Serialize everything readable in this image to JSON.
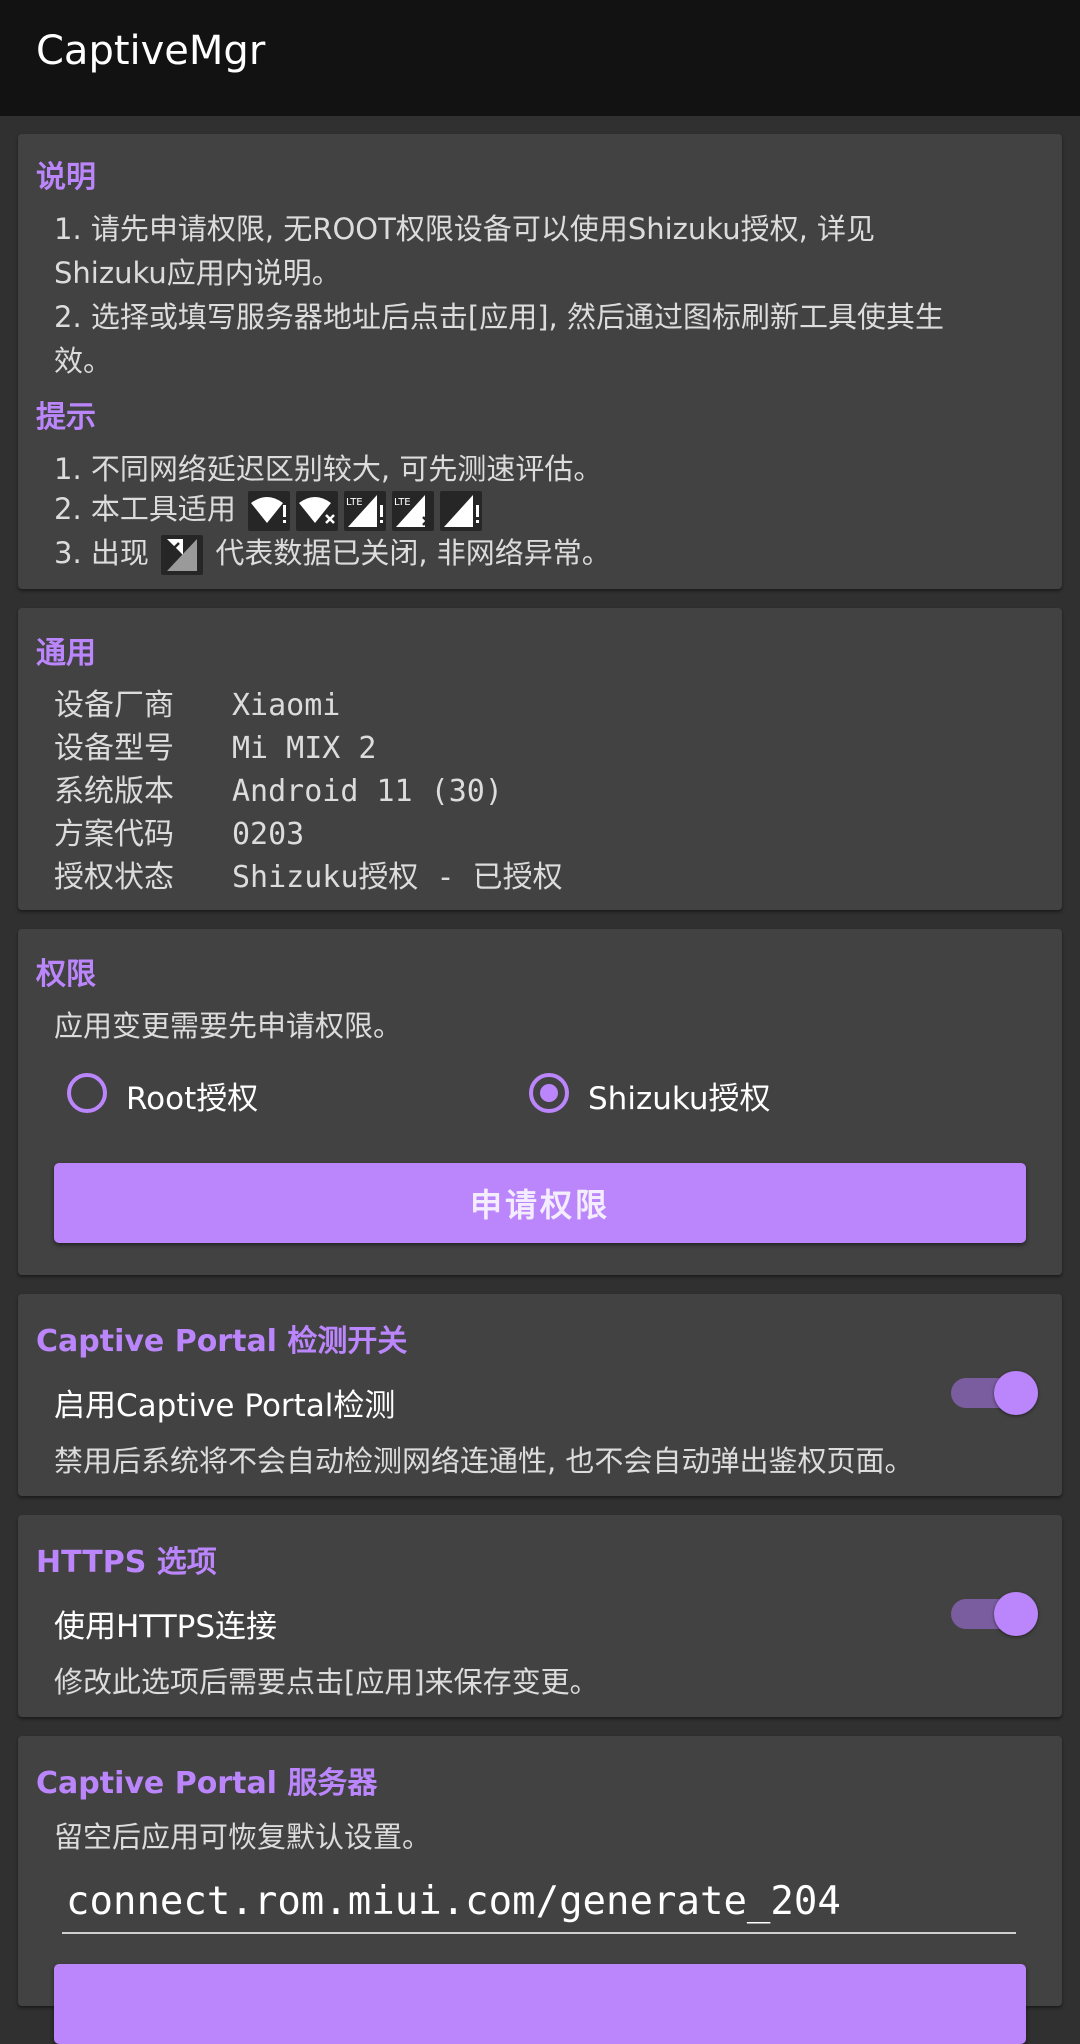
{
  "app": {
    "title": "CaptiveMgr"
  },
  "instructions": {
    "title": "说明",
    "lines": [
      "1. 请先申请权限, 无ROOT权限设备可以使用Shizuku授权, 详见",
      "Shizuku应用内说明。",
      "2. 选择或填写服务器地址后点击[应用], 然后通过图标刷新工具使其生",
      "效。"
    ]
  },
  "tips": {
    "title": "提示",
    "line1": "1. 不同网络延迟区别较大, 可先测速评估。",
    "line2_prefix": "2. 本工具适用",
    "line3_prefix": "3. 出现",
    "line3_suffix": "代表数据已关闭, 非网络异常。",
    "icons": [
      "wifi-exclamation-icon",
      "wifi-x-icon",
      "lte-exclamation-icon",
      "lte-x-icon",
      "signal-exclamation-icon",
      "mobile-data-off-icon"
    ],
    "lte_text": "LTE"
  },
  "general": {
    "title": "通用",
    "rows": [
      {
        "label": "设备厂商",
        "value": "Xiaomi"
      },
      {
        "label": "设备型号",
        "value": "Mi MIX 2"
      },
      {
        "label": "系统版本",
        "value": "Android 11 (30)"
      },
      {
        "label": "方案代码",
        "value": "0203"
      },
      {
        "label": "授权状态",
        "value": "Shizuku授权 - 已授权"
      }
    ]
  },
  "permission": {
    "title": "权限",
    "desc": "应用变更需要先申请权限。",
    "options": [
      {
        "label": "Root授权",
        "selected": false
      },
      {
        "label": "Shizuku授权",
        "selected": true
      }
    ],
    "button": "申请权限"
  },
  "detection": {
    "title": "Captive Portal 检测开关",
    "toggle_label": "启用Captive Portal检测",
    "enabled": true,
    "desc": "禁用后系统将不会自动检测网络连通性, 也不会自动弹出鉴权页面。"
  },
  "https": {
    "title": "HTTPS 选项",
    "toggle_label": "使用HTTPS连接",
    "enabled": true,
    "desc": "修改此选项后需要点击[应用]来保存变更。"
  },
  "server": {
    "title": "Captive Portal 服务器",
    "desc": "留空后应用可恢复默认设置。",
    "value": "connect.rom.miui.com/generate_204"
  },
  "colors": {
    "accent": "#bb86fc",
    "background": "#303030",
    "card": "#424242",
    "appbar": "#121212"
  }
}
